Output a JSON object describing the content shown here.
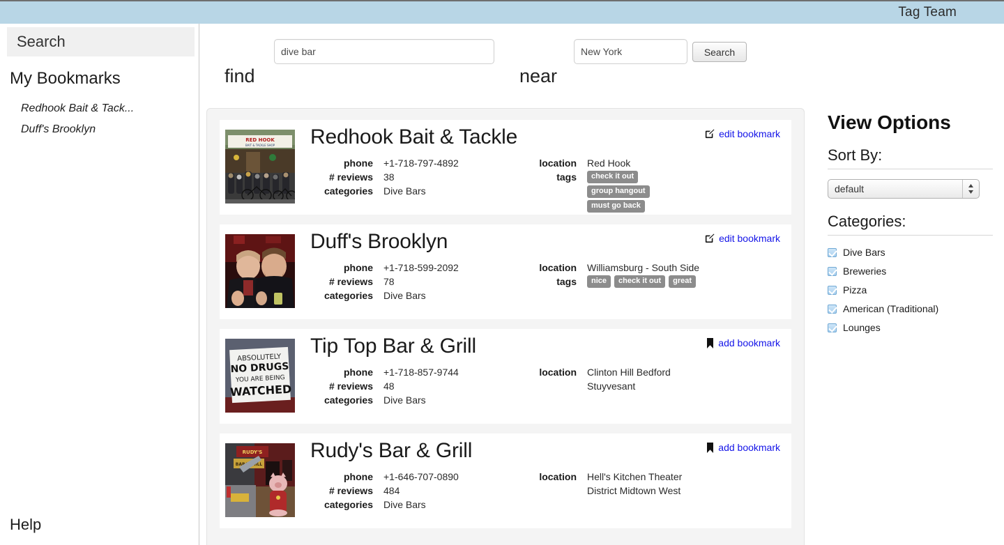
{
  "topbar": {
    "brand": "Tag Team"
  },
  "sidebar": {
    "search_label": "Search",
    "bookmarks_title": "My Bookmarks",
    "bookmarks": [
      {
        "label": "Redhook Bait & Tack..."
      },
      {
        "label": "Duff's Brooklyn"
      }
    ],
    "help_label": "Help"
  },
  "search": {
    "find_label": "find",
    "find_value": "dive bar",
    "near_label": "near",
    "near_value": "New York",
    "button_label": "Search"
  },
  "results": [
    {
      "name": "Redhook Bait & Tackle",
      "phone_label": "phone",
      "phone": "+1-718-797-4892",
      "reviews_label": "# reviews",
      "reviews": "38",
      "categories_label": "categories",
      "categories": "Dive Bars",
      "location_label": "location",
      "location": "Red Hook",
      "tags_label": "tags",
      "tags": [
        "check it out",
        "group hangout",
        "must go back"
      ],
      "tags_stacked": true,
      "bookmark_label": "edit bookmark",
      "bookmark_icon": "edit-pencil-square-icon",
      "bookmark_glyph": "✎",
      "thumb_alt": "Red Hook Bait & Tackle Shop storefront with crowd"
    },
    {
      "name": "Duff's Brooklyn",
      "phone_label": "phone",
      "phone": "+1-718-599-2092",
      "reviews_label": "# reviews",
      "reviews": "78",
      "categories_label": "categories",
      "categories": "Dive Bars",
      "location_label": "location",
      "location": "Williamsburg - South Side",
      "tags_label": "tags",
      "tags": [
        "nice",
        "check it out",
        "great"
      ],
      "tags_stacked": false,
      "bookmark_label": "edit bookmark",
      "bookmark_icon": "edit-pencil-square-icon",
      "bookmark_glyph": "✎",
      "thumb_alt": "Two men posing in a red-lit bar"
    },
    {
      "name": "Tip Top Bar & Grill",
      "phone_label": "phone",
      "phone": "+1-718-857-9744",
      "reviews_label": "# reviews",
      "reviews": "48",
      "categories_label": "categories",
      "categories": "Dive Bars",
      "location_label": "location",
      "location": "Clinton Hill Bedford Stuyvesant",
      "tags_label": "tags",
      "tags": [],
      "tags_stacked": false,
      "bookmark_label": "add bookmark",
      "bookmark_icon": "bookmark-flag-icon",
      "bookmark_glyph": "⚑",
      "thumb_alt": "Sign reading ABSOLUTELY NO DRUGS YOU ARE BEING WATCHED"
    },
    {
      "name": "Rudy's Bar & Grill",
      "phone_label": "phone",
      "phone": "+1-646-707-0890",
      "reviews_label": "# reviews",
      "reviews": "484",
      "categories_label": "categories",
      "categories": "Dive Bars",
      "location_label": "location",
      "location": "Hell's Kitchen Theater District Midtown West",
      "tags_label": "tags",
      "tags": [],
      "tags_stacked": false,
      "bookmark_label": "add bookmark",
      "bookmark_icon": "bookmark-flag-icon",
      "bookmark_glyph": "⚑",
      "thumb_alt": "Rudy's Bar & Grill storefront with pig mascot statue"
    }
  ],
  "view_options": {
    "title": "View Options",
    "sort_label": "Sort By:",
    "sort_value": "default",
    "sort_options": [
      "default"
    ],
    "categories_label": "Categories:",
    "categories": [
      {
        "label": "Dive Bars",
        "checked": true
      },
      {
        "label": "Breweries",
        "checked": true
      },
      {
        "label": "Pizza",
        "checked": true
      },
      {
        "label": "American (Traditional)",
        "checked": true
      },
      {
        "label": "Lounges",
        "checked": true
      }
    ]
  },
  "colors": {
    "header_bg": "#b8d6e6",
    "link": "#1414e8",
    "tag_bg": "#8c8c8c",
    "panel_bg": "#f4f4f4",
    "checkbox": "#a9d0ef"
  }
}
